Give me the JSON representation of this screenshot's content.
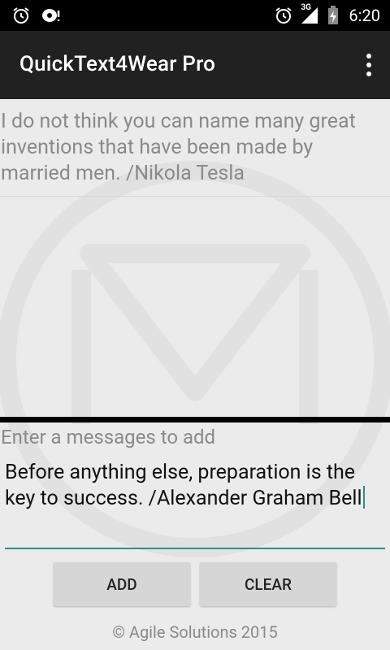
{
  "status_bar": {
    "time": "6:20",
    "network": "3G",
    "icons": [
      "alarm-icon",
      "debug-notification-icon",
      "alarm-icon",
      "signal-icon",
      "battery-charging-icon"
    ]
  },
  "app_bar": {
    "title": "QuickText4Wear Pro",
    "overflow_icon": "more-vert-icon"
  },
  "messages": [
    "I do not think you can name many great inventions that have been made by married men. /Nikola Tesla"
  ],
  "composer": {
    "prompt": "Enter a messages to add",
    "value": "Before anything else, preparation is the key to success. /Alexander Graham Bell",
    "accent_color": "#2e8f87"
  },
  "buttons": {
    "add_label": "ADD",
    "clear_label": "CLEAR"
  },
  "footer": {
    "text": "© Agile Solutions 2015"
  },
  "colors": {
    "app_bar": "#212121",
    "background": "#ebebeb"
  }
}
